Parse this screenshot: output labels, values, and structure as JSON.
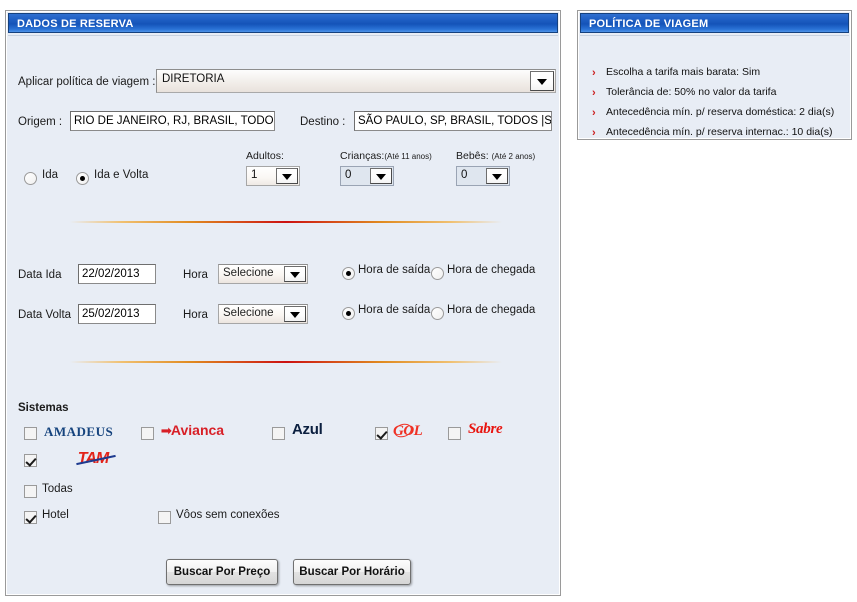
{
  "booking": {
    "title": "DADOS DE RESERVA",
    "policy_label": "Aplicar política de viagem :",
    "policy_value": "DIRETORIA",
    "origin_label": "Origem :",
    "origin_value": "RIO DE JANEIRO, RJ, BRASIL, TODOS",
    "destination_label": "Destino :",
    "destination_value": "SÃO PAULO, SP, BRASIL, TODOS |SAO",
    "trip": {
      "oneway_label": "Ida",
      "oneway_selected": false,
      "roundtrip_label": "Ida e Volta",
      "roundtrip_selected": true
    },
    "passengers": {
      "adults_label": "Adultos:",
      "adults_value": "1",
      "children_label": "Crianças:",
      "children_note": "(Até 11 anos)",
      "children_value": "0",
      "infants_label": "Bebês:",
      "infants_note": "(Até 2 anos)",
      "infants_value": "0"
    },
    "dates": {
      "depart_label": "Data Ida",
      "depart_value": "22/02/2013",
      "return_label": "Data Volta",
      "return_value": "25/02/2013",
      "hour_label": "Hora",
      "hour_placeholder": "Selecione",
      "depart_hour_value": "Selecione",
      "return_hour_value": "Selecione",
      "departure_time_label": "Hora de saída",
      "arrival_time_label": "Hora de chegada",
      "depart_row_departure_selected": true,
      "depart_row_arrival_selected": false,
      "return_row_departure_selected": true,
      "return_row_arrival_selected": false
    },
    "systems": {
      "heading": "Sistemas",
      "items": [
        {
          "name": "AMADEUS",
          "checked": false
        },
        {
          "name": "Avianca",
          "checked": false
        },
        {
          "name": "Azul",
          "checked": false
        },
        {
          "name": "GOL",
          "checked": true
        },
        {
          "name": "Sabre",
          "checked": false
        },
        {
          "name": "TAM",
          "checked": true
        }
      ],
      "all_label": "Todas",
      "all_checked": false,
      "hotel_label": "Hotel",
      "hotel_checked": true,
      "nonstop_label": "Vôos sem conexões",
      "nonstop_checked": false
    },
    "buttons": {
      "search_price": "Buscar Por Preço",
      "search_time": "Buscar Por Horário"
    }
  },
  "policy": {
    "title": "POLÍTICA DE VIAGEM",
    "items": [
      "Escolha a tarifa mais barata: Sim",
      "Tolerância de: 50% no valor da tarifa",
      "Antecedência mín. p/ reserva doméstica: 2 dia(s)",
      "Antecedência mín. p/ reserva internac.: 10 dia(s)"
    ],
    "bullet": "›"
  },
  "colors": {
    "header_blue": "#1f5fc4",
    "panel_bg": "#e8edf5",
    "divider_red": "#cc1111",
    "accent_red": "#e2231a"
  }
}
